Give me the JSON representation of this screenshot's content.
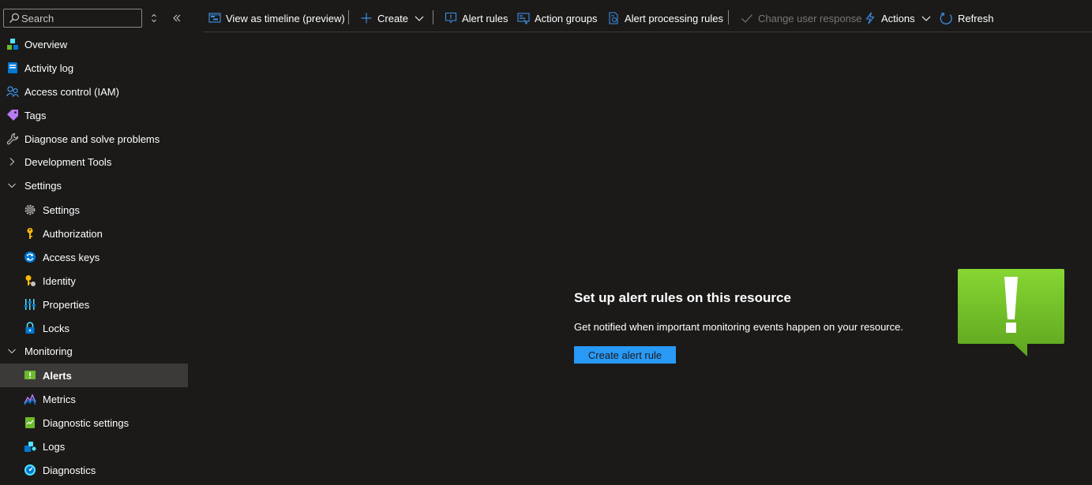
{
  "sidebar": {
    "search_placeholder": "Search",
    "items": [
      {
        "label": "Overview",
        "icon": "overview-icon"
      },
      {
        "label": "Activity log",
        "icon": "activity-log-icon"
      },
      {
        "label": "Access control (IAM)",
        "icon": "access-control-icon"
      },
      {
        "label": "Tags",
        "icon": "tag-icon"
      },
      {
        "label": "Diagnose and solve problems",
        "icon": "wrench-icon"
      },
      {
        "label": "Development Tools",
        "icon": "chevron-right-icon"
      },
      {
        "label": "Settings",
        "icon": "chevron-down-icon"
      },
      {
        "label": "Settings",
        "icon": "gear-icon"
      },
      {
        "label": "Authorization",
        "icon": "key-icon"
      },
      {
        "label": "Access keys",
        "icon": "access-keys-icon"
      },
      {
        "label": "Identity",
        "icon": "identity-icon"
      },
      {
        "label": "Properties",
        "icon": "properties-icon"
      },
      {
        "label": "Locks",
        "icon": "lock-icon"
      },
      {
        "label": "Monitoring",
        "icon": "chevron-down-icon"
      },
      {
        "label": "Alerts",
        "icon": "alerts-icon"
      },
      {
        "label": "Metrics",
        "icon": "metrics-icon"
      },
      {
        "label": "Diagnostic settings",
        "icon": "diagnostic-settings-icon"
      },
      {
        "label": "Logs",
        "icon": "logs-icon"
      },
      {
        "label": "Diagnostics",
        "icon": "diagnostics-icon"
      }
    ]
  },
  "toolbar": {
    "view_timeline": "View as timeline (preview)",
    "create": "Create",
    "alert_rules": "Alert rules",
    "action_groups": "Action groups",
    "alert_processing_rules": "Alert processing rules",
    "change_user_response": "Change user response",
    "actions": "Actions",
    "refresh": "Refresh"
  },
  "empty_state": {
    "title": "Set up alert rules on this resource",
    "description": "Get notified when important monitoring events happen on your resource.",
    "button": "Create alert rule"
  },
  "colors": {
    "background": "#1b1a19",
    "accent": "#2899f5",
    "selected": "#3b3a39",
    "alert_green": "#6cba2d"
  }
}
